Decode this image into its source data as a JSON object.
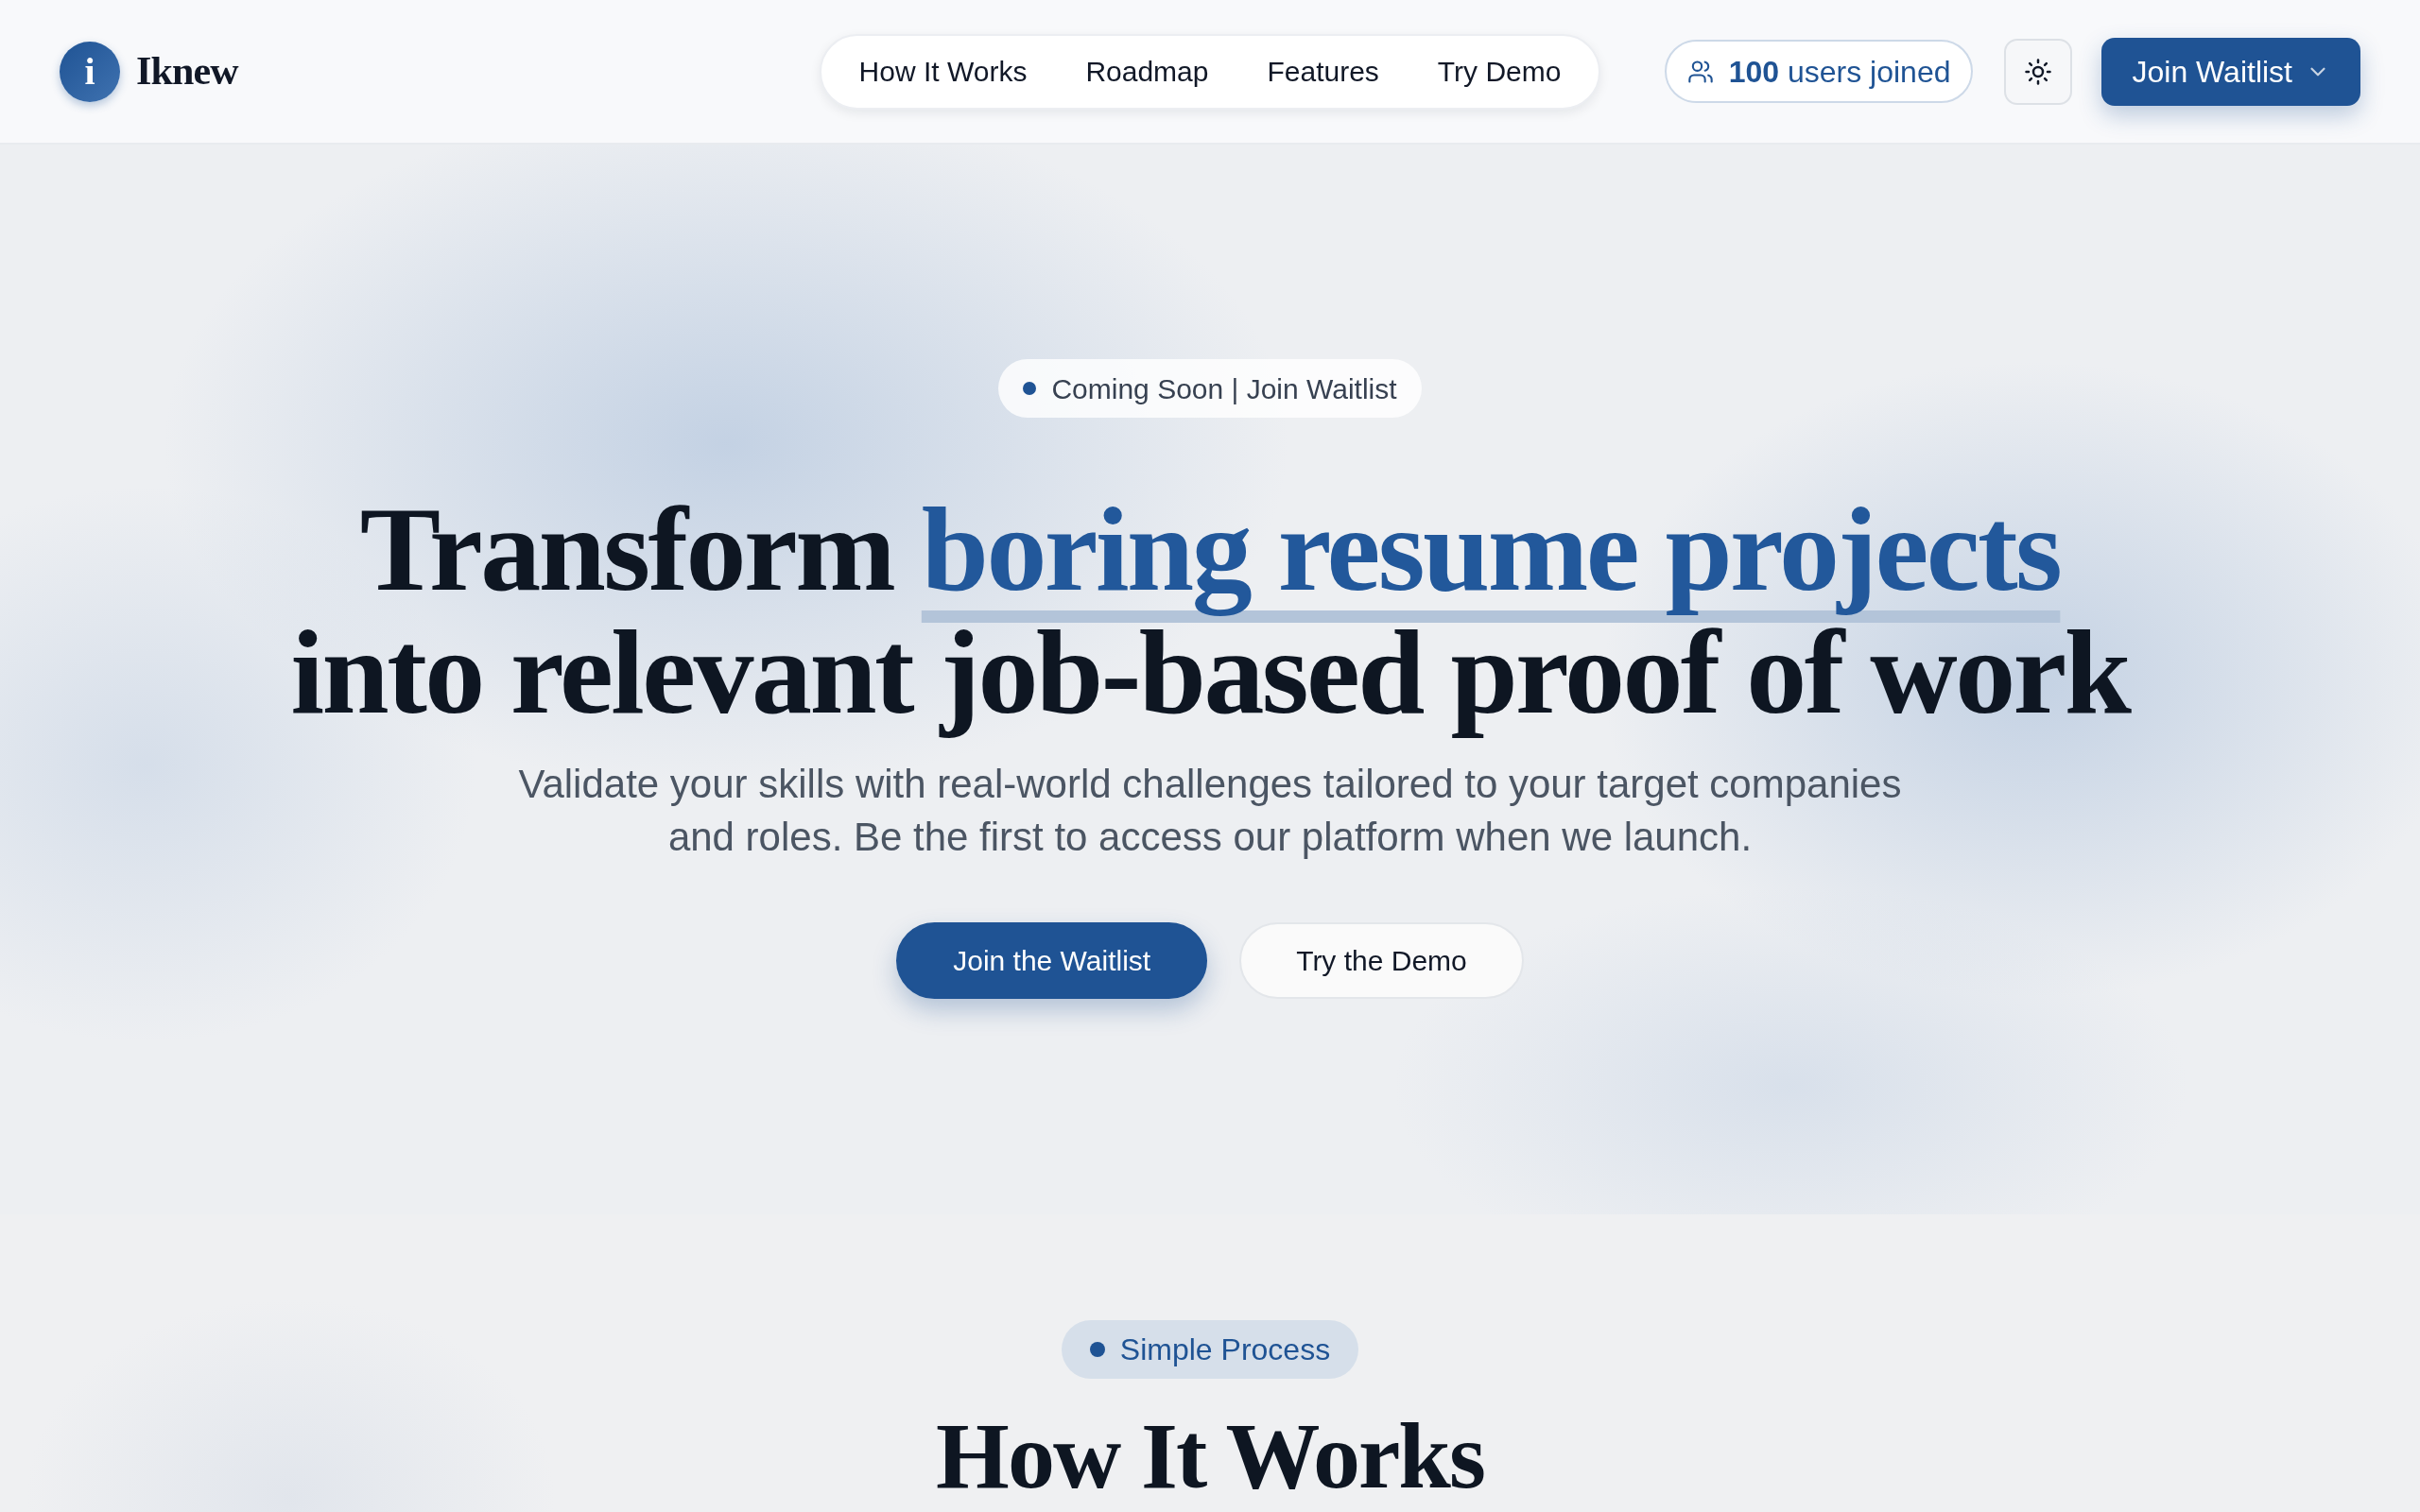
{
  "header": {
    "logo": {
      "mark": "i",
      "name": "Iknew"
    },
    "nav": [
      {
        "label": "How It Works"
      },
      {
        "label": "Roadmap"
      },
      {
        "label": "Features"
      },
      {
        "label": "Try Demo"
      }
    ],
    "users_badge": "**100** users joined",
    "cta": "Join Waitlist"
  },
  "hero": {
    "badge": "Coming Soon | Join Waitlist",
    "headline_lines": [
      [
        {
          "text": "Transform",
          "kind": "plain"
        },
        {
          "text": "boring resume projects",
          "kind": "highlight"
        }
      ],
      [
        {
          "text": "into relevant job-based proof of work",
          "kind": "plain"
        }
      ]
    ],
    "subtitle": "Validate your skills with real-world challenges tailored to your target companies and roles. Be the first to access our platform when we launch.",
    "buttons": [
      {
        "label": "Join the Waitlist",
        "kind": "primary"
      },
      {
        "label": "Try the Demo",
        "kind": "secondary"
      }
    ]
  },
  "how_it_works": {
    "badge": "Simple Process",
    "title": "How It Works"
  }
}
